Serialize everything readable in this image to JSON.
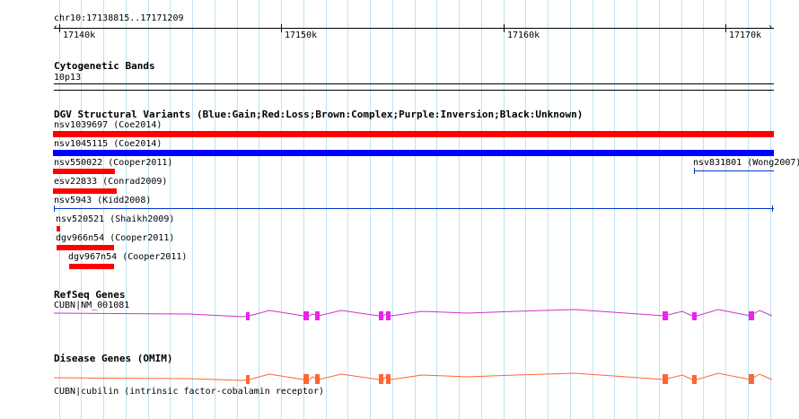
{
  "region": "chr10:17138815..17171209",
  "ruler": {
    "ticks": [
      "17140k",
      "17150k",
      "17160k",
      "17170k"
    ]
  },
  "cytoband": {
    "title": "Cytogenetic Bands",
    "band": "10p13"
  },
  "dgv": {
    "title": "DGV Structural Variants (Blue:Gain;Red:Loss;Brown:Complex;Purple:Inversion;Black:Unknown)",
    "colors": {
      "gain": "#0000ff",
      "loss": "#ff0000",
      "unknown": "#0033cc"
    },
    "features": [
      {
        "label": "nsv1039697 (Coe2014)",
        "type": "loss"
      },
      {
        "label": "nsv1045115 (Coe2014)",
        "type": "gain"
      },
      {
        "label": "nsv550022 (Cooper2011)",
        "type": "loss"
      },
      {
        "label": "nsv831801 (Wong2007)",
        "type": "unknown"
      },
      {
        "label": "esv22833 (Conrad2009)",
        "type": "loss"
      },
      {
        "label": "nsv5943 (Kidd2008)",
        "type": "unknown"
      },
      {
        "label": "nsv520521 (Shaikh2009)",
        "type": "loss"
      },
      {
        "label": "dgv966n54 (Cooper2011)",
        "type": "loss"
      },
      {
        "label": "dgv967n54 (Cooper2011)",
        "type": "loss"
      }
    ]
  },
  "refseq": {
    "title": "RefSeq Genes",
    "gene_label": "CUBN|NM_001081",
    "color": "#e020e0",
    "line_color": "#cc33cc"
  },
  "omim": {
    "title": "Disease Genes (OMIM)",
    "gene_label": "CUBN|cubilin (intrinsic factor-cobalamin receptor)",
    "color": "#ff6633",
    "line_color": "#ff6633"
  }
}
